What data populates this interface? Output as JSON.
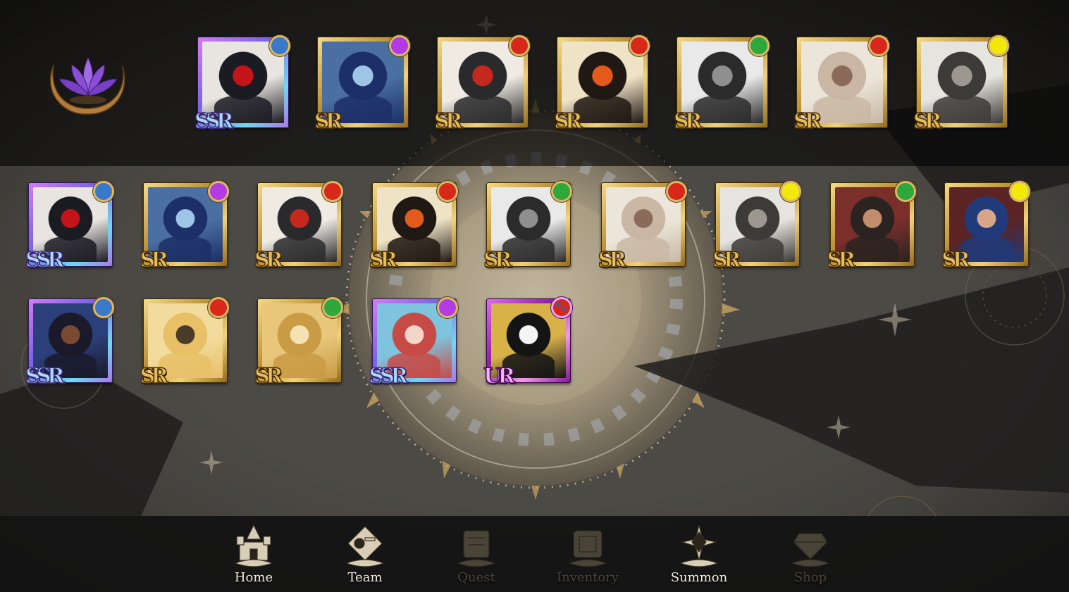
{
  "attribute_colors": {
    "blue": "#3a79c9",
    "purple": "#b23be6",
    "red": "#d7281a",
    "green": "#2ea83b",
    "yellow": "#f2e90b"
  },
  "emblem": {
    "icon": "purple-lotus-crescent-icon"
  },
  "team_row": [
    {
      "rarity": "SSR",
      "attribute": "blue",
      "portrait": "dark-hair-red-eye-boy"
    },
    {
      "rarity": "SR",
      "attribute": "purple",
      "portrait": "blue-hair-girl"
    },
    {
      "rarity": "SR",
      "attribute": "red",
      "portrait": "masked-ninja"
    },
    {
      "rarity": "SR",
      "attribute": "red",
      "portrait": "orange-scarf-boy"
    },
    {
      "rarity": "SR",
      "attribute": "green",
      "portrait": "coat-boy-monochrome"
    },
    {
      "rarity": "SR",
      "attribute": "red",
      "portrait": "nurse-girl"
    },
    {
      "rarity": "SR",
      "attribute": "yellow",
      "portrait": "silver-hair-figure"
    }
  ],
  "inventory_rows": [
    [
      {
        "rarity": "SSR",
        "attribute": "blue",
        "portrait": "dark-hair-red-eye-boy"
      },
      {
        "rarity": "SR",
        "attribute": "purple",
        "portrait": "blue-hair-girl"
      },
      {
        "rarity": "SR",
        "attribute": "red",
        "portrait": "masked-ninja"
      },
      {
        "rarity": "SR",
        "attribute": "red",
        "portrait": "orange-scarf-boy"
      },
      {
        "rarity": "SR",
        "attribute": "green",
        "portrait": "coat-boy-monochrome"
      },
      {
        "rarity": "SR",
        "attribute": "red",
        "portrait": "nurse-girl"
      },
      {
        "rarity": "SR",
        "attribute": "yellow",
        "portrait": "silver-hair-figure"
      },
      {
        "rarity": "SR",
        "attribute": "green",
        "portrait": "bearded-footballer"
      },
      {
        "rarity": "SR",
        "attribute": "yellow",
        "portrait": "footballer-blue-shirt"
      }
    ],
    [
      {
        "rarity": "SSR",
        "attribute": "blue",
        "portrait": "laughing-footballer"
      },
      {
        "rarity": "SR",
        "attribute": "red",
        "portrait": "blonde-girl-shouting"
      },
      {
        "rarity": "SR",
        "attribute": "green",
        "portrait": "blonde-boy-smiling"
      },
      {
        "rarity": "SSR",
        "attribute": "purple",
        "portrait": "red-hair-woman"
      },
      {
        "rarity": "UR",
        "attribute": "red",
        "attribute_icon": "paw-icon",
        "portrait": "black-hair-angel-girl"
      }
    ]
  ],
  "nav": [
    {
      "label": "Home",
      "icon": "castle-icon",
      "active": true
    },
    {
      "label": "Team",
      "icon": "weapons-icon",
      "active": true
    },
    {
      "label": "Quest",
      "icon": "quest-scroll-icon",
      "active": false
    },
    {
      "label": "Inventory",
      "icon": "chest-icon",
      "active": false
    },
    {
      "label": "Summon",
      "icon": "star-compass-icon",
      "active": true
    },
    {
      "label": "Shop",
      "icon": "gem-icon",
      "active": false
    }
  ]
}
